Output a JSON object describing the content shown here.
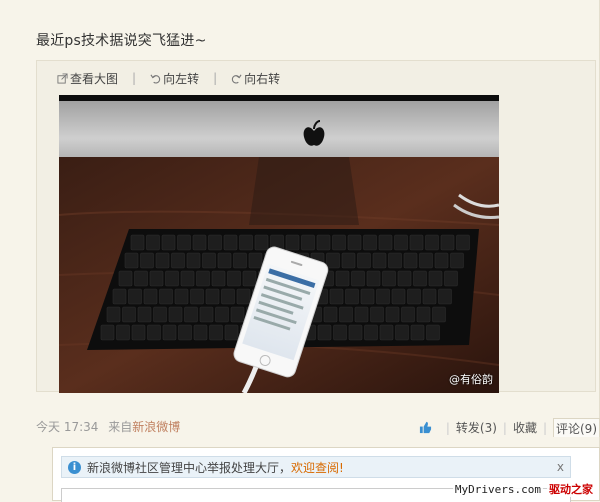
{
  "post": {
    "text": "最近ps技术据说突飞猛进~"
  },
  "media_toolbar": {
    "view_large": "查看大图",
    "rotate_left": "向左转",
    "rotate_right": "向右转",
    "separator": "|"
  },
  "photo": {
    "watermark": "@有俗韵"
  },
  "meta": {
    "time": "今天 17:34",
    "from_label": "来自",
    "source": "新浪微博",
    "repost": "转发(3)",
    "favorite": "收藏",
    "comment": "评论(9)",
    "separator": "|"
  },
  "comments": {
    "notice_text": "新浪微博社区管理中心举报处理大厅，",
    "notice_link": "欢迎查阅!",
    "close": "x"
  },
  "site_brand": {
    "en": "MyDrivers.com",
    "cn": "驱动之家"
  },
  "colors": {
    "background": "#f7f4ea",
    "link_orange": "#d86a00",
    "source_link": "#c08060",
    "info_blue": "#3a8fd1"
  }
}
